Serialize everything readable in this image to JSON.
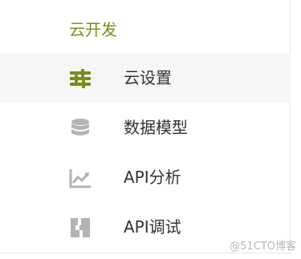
{
  "section": {
    "title": "云开发"
  },
  "menu": {
    "items": [
      {
        "label": "云设置",
        "icon": "sliders-icon",
        "active": true
      },
      {
        "label": "数据模型",
        "icon": "database-icon",
        "active": false
      },
      {
        "label": "API分析",
        "icon": "trend-chart-icon",
        "active": false
      },
      {
        "label": "API调试",
        "icon": "api-debug-icon",
        "active": false
      }
    ]
  },
  "watermark": {
    "text": "@51CTO博客"
  },
  "colors": {
    "accent": "#7b8c1a",
    "icon_gray": "#b3b3b3",
    "text": "#333333",
    "active_bg": "#f5f6f5"
  }
}
